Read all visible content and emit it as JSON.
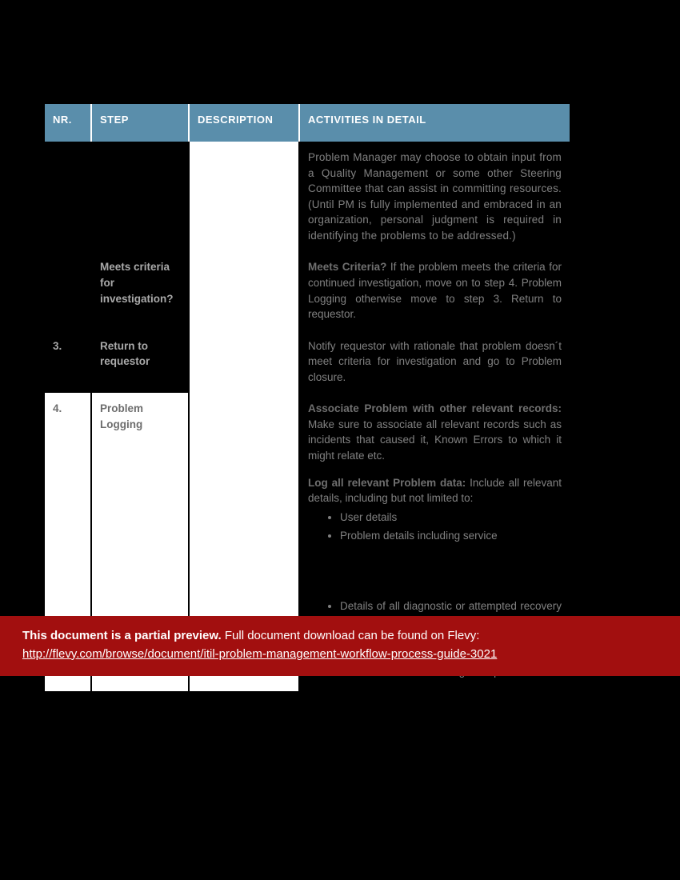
{
  "table": {
    "headers": {
      "nr": "NR.",
      "step": "STEP",
      "desc": "DESCRIPTION",
      "act": "ACTIVITIES IN DETAIL"
    },
    "rows": {
      "r1": {
        "nr": "",
        "step": "",
        "act": "Problem Manager may choose to obtain input from a Quality Management or some other Steering Committee that can assist in committing resources.   (Until PM is fully implemented and embraced in an organization, personal judgment is required in identifying the problems to be addressed.)"
      },
      "r2": {
        "nr": "",
        "step": "Meets criteria for investigation?",
        "lead": "Meets Criteria?",
        "act": "  If the problem meets the criteria for continued investigation, move on to step 4. Problem Logging otherwise move to step 3. Return to requestor."
      },
      "r3": {
        "nr": "3.",
        "step": "Return to requestor",
        "act": "Notify requestor with rationale that problem doesn´t meet criteria for investigation and go to Problem closure."
      },
      "r4": {
        "nr": "4.",
        "step": "Problem Logging",
        "p1_lead": "Associate Problem with other relevant records:",
        "p1_rest": " Make sure to associate all relevant records such as incidents that caused it, Known Errors to which it might relate etc.",
        "p2_lead": "Log all relevant Problem data:",
        "p2_rest": " Include all relevant details, including but not limited to:",
        "bullets": {
          "b1": "User details",
          "b2": "Problem details including service",
          "b3": "Details of all diagnostic or attempted recovery actions taken, for problem team consideration to create as a formal KM record",
          "b4": "Description of how the problem met the criteria to become a recognized problem."
        }
      }
    }
  },
  "banner": {
    "bold": "This document is a partial preview.",
    "rest": "  Full document download can be found on Flevy:",
    "link": "http://flevy.com/browse/document/itil-problem-management-workflow-process-guide-3021"
  }
}
